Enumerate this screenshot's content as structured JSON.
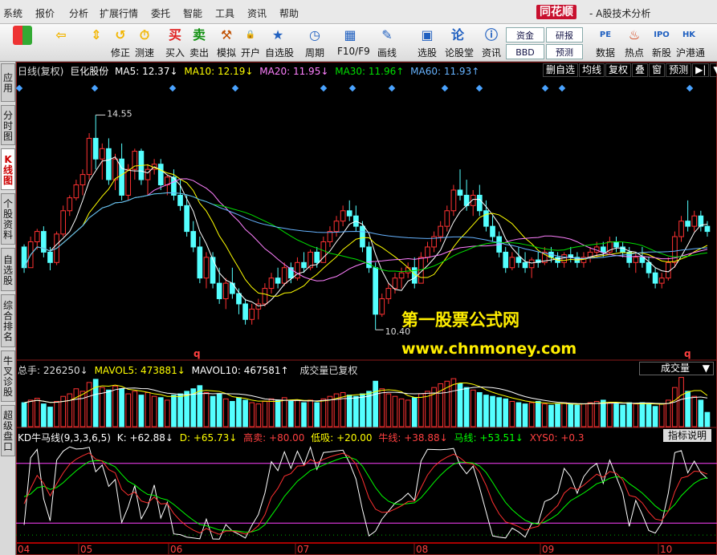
{
  "menu": [
    "系统",
    "报价",
    "分析",
    "扩展行情",
    "委托",
    "智能",
    "工具",
    "资讯",
    "帮助"
  ],
  "brand": {
    "logo": "同花顺",
    "title": "- A股技术分析"
  },
  "toolbar": {
    "items": [
      {
        "name": "home",
        "label": ""
      },
      {
        "name": "back",
        "label": ""
      },
      {
        "name": "updown",
        "label": ""
      },
      {
        "name": "correct",
        "label": "修正"
      },
      {
        "name": "speed",
        "label": "测速"
      },
      {
        "name": "buy",
        "label": "买入"
      },
      {
        "name": "sell",
        "label": "卖出"
      },
      {
        "name": "simulate",
        "label": "模拟"
      },
      {
        "name": "open-account",
        "label": "开户"
      },
      {
        "name": "watchlist",
        "label": "自选股"
      },
      {
        "name": "period",
        "label": "周期"
      },
      {
        "name": "f10",
        "label": "F10/F9"
      },
      {
        "name": "draw",
        "label": "画线"
      },
      {
        "name": "select-stock",
        "label": "选股"
      },
      {
        "name": "forum",
        "label": "论股堂"
      },
      {
        "name": "news",
        "label": "资讯"
      },
      {
        "name": "data",
        "label": "数据"
      },
      {
        "name": "hot",
        "label": "热点"
      },
      {
        "name": "new-stock",
        "label": "新股"
      },
      {
        "name": "hk-connect",
        "label": "沪港通"
      }
    ],
    "small_buttons": [
      "资金",
      "研报",
      "BBD",
      "预测"
    ]
  },
  "sidebar": [
    "应用",
    "分时图",
    "K线图",
    "个股资料",
    "自选股",
    "综合排名",
    "牛叉诊股",
    "超级盘口"
  ],
  "price_panel": {
    "legend": {
      "label": "日线(复权)",
      "stock": "巨化股份",
      "ma5": "MA5: 12.37↓",
      "ma10": "MA10: 12.19↓",
      "ma20": "MA20: 11.95↓",
      "ma30": "MA30: 11.96↑",
      "ma60": "MA60: 11.93↑"
    },
    "buttons": [
      "删自选",
      "均线",
      "复权",
      "叠",
      "窗",
      "预测"
    ],
    "max_label": "14.55",
    "min_label": "10.40",
    "marker": "q"
  },
  "volume_panel": {
    "legend": {
      "total": "总手: 226250↓",
      "mavol5": "MAVOL5: 473881↓",
      "mavol10": "MAVOL10: 467581↑",
      "note": "成交量已复权"
    },
    "selector": "成交量"
  },
  "kd_panel": {
    "legend": {
      "name": "KD牛马线(9,3,3,6,5)",
      "k": "K: +62.88↓",
      "d": "D: +65.73↓",
      "high": "高卖: +80.00",
      "low": "低吸: +20.00",
      "bull": "牛线: +38.88↓",
      "horse": "马线: +53.51↓",
      "xys": "XYS0: +0.3"
    },
    "button": "指标说明"
  },
  "x_axis": [
    "04",
    "05",
    "06",
    "07",
    "08",
    "09",
    "10"
  ],
  "watermark": [
    "第一股票公式网",
    "www.chnmoney.com"
  ],
  "colors": {
    "up": "#ff3232",
    "down": "#54ffff",
    "ma5": "#ffffff",
    "ma10": "#ffff00",
    "ma20": "#ff80ff",
    "ma30": "#00e000",
    "ma60": "#66b3ff",
    "kline": "#ff3030",
    "dline": "#00ff00",
    "jline": "#ffffff"
  },
  "chart_data": {
    "type": "candlestick",
    "price_range": [
      10.0,
      15.3
    ],
    "ohlc": [
      [
        12.0,
        12.05,
        11.5,
        11.6
      ],
      [
        11.6,
        12.2,
        11.6,
        12.1
      ],
      [
        12.1,
        12.35,
        11.95,
        12.3
      ],
      [
        12.3,
        12.4,
        11.8,
        11.9
      ],
      [
        11.9,
        12.0,
        11.55,
        11.7
      ],
      [
        11.7,
        12.3,
        11.65,
        12.25
      ],
      [
        12.25,
        12.8,
        12.2,
        12.7
      ],
      [
        12.7,
        13.0,
        12.6,
        12.95
      ],
      [
        12.95,
        13.3,
        12.9,
        13.2
      ],
      [
        13.2,
        13.5,
        13.0,
        13.4
      ],
      [
        13.4,
        14.2,
        13.3,
        14.1
      ],
      [
        14.1,
        14.55,
        13.5,
        13.7
      ],
      [
        13.7,
        14.0,
        13.3,
        13.9
      ],
      [
        13.9,
        14.1,
        13.2,
        13.3
      ],
      [
        13.3,
        13.8,
        13.1,
        13.7
      ],
      [
        13.7,
        14.0,
        12.9,
        13.0
      ],
      [
        13.0,
        13.6,
        12.9,
        13.5
      ],
      [
        13.5,
        13.9,
        13.3,
        13.85
      ],
      [
        13.85,
        13.9,
        13.2,
        13.3
      ],
      [
        13.3,
        13.6,
        13.0,
        13.5
      ],
      [
        13.5,
        13.7,
        13.4,
        13.6
      ],
      [
        13.6,
        13.7,
        13.1,
        13.2
      ],
      [
        13.2,
        13.4,
        13.0,
        13.35
      ],
      [
        13.35,
        13.5,
        12.9,
        13.0
      ],
      [
        13.0,
        13.3,
        12.7,
        12.8
      ],
      [
        12.8,
        13.0,
        12.2,
        12.3
      ],
      [
        12.3,
        12.5,
        11.9,
        12.0
      ],
      [
        12.0,
        12.2,
        11.3,
        11.4
      ],
      [
        11.4,
        11.9,
        11.2,
        11.8
      ],
      [
        11.8,
        11.9,
        11.2,
        11.3
      ],
      [
        11.3,
        11.6,
        10.9,
        11.0
      ],
      [
        11.0,
        11.4,
        10.8,
        11.3
      ],
      [
        11.3,
        11.6,
        11.0,
        11.1
      ],
      [
        11.1,
        11.2,
        10.7,
        10.9
      ],
      [
        10.9,
        11.0,
        10.5,
        10.6
      ],
      [
        10.6,
        10.9,
        10.5,
        10.8
      ],
      [
        10.8,
        11.0,
        10.6,
        10.9
      ],
      [
        10.9,
        11.3,
        10.85,
        11.2
      ],
      [
        11.2,
        11.5,
        11.1,
        11.4
      ],
      [
        11.4,
        11.6,
        11.2,
        11.3
      ],
      [
        11.3,
        11.7,
        11.25,
        11.6
      ],
      [
        11.6,
        11.7,
        11.3,
        11.4
      ],
      [
        11.4,
        11.8,
        11.35,
        11.7
      ],
      [
        11.7,
        11.9,
        11.5,
        11.6
      ],
      [
        11.6,
        11.95,
        11.55,
        11.9
      ],
      [
        11.9,
        12.0,
        11.6,
        11.7
      ],
      [
        11.7,
        12.2,
        11.7,
        12.1
      ],
      [
        12.1,
        12.4,
        12.0,
        12.3
      ],
      [
        12.3,
        12.6,
        12.2,
        12.5
      ],
      [
        12.5,
        12.8,
        12.4,
        12.7
      ],
      [
        12.7,
        12.9,
        12.5,
        12.6
      ],
      [
        12.6,
        12.8,
        12.3,
        12.4
      ],
      [
        12.4,
        12.5,
        11.9,
        12.0
      ],
      [
        12.0,
        12.1,
        11.5,
        11.6
      ],
      [
        11.6,
        11.7,
        10.4,
        10.7
      ],
      [
        10.7,
        11.1,
        10.65,
        11.0
      ],
      [
        11.0,
        11.3,
        10.9,
        11.2
      ],
      [
        11.2,
        11.5,
        11.1,
        11.4
      ],
      [
        11.4,
        11.6,
        11.2,
        11.5
      ],
      [
        11.5,
        11.7,
        11.4,
        11.6
      ],
      [
        11.6,
        11.8,
        11.2,
        11.3
      ],
      [
        11.3,
        11.9,
        11.3,
        11.8
      ],
      [
        11.8,
        12.1,
        11.7,
        12.0
      ],
      [
        12.0,
        12.3,
        11.9,
        12.2
      ],
      [
        12.2,
        12.5,
        12.1,
        12.4
      ],
      [
        12.4,
        12.8,
        12.3,
        12.7
      ],
      [
        12.7,
        13.2,
        12.6,
        13.1
      ],
      [
        13.1,
        13.5,
        12.9,
        13.0
      ],
      [
        13.0,
        13.3,
        12.7,
        12.8
      ],
      [
        12.8,
        13.1,
        12.6,
        13.0
      ],
      [
        13.0,
        13.2,
        12.6,
        12.7
      ],
      [
        12.7,
        12.9,
        12.3,
        12.4
      ],
      [
        12.4,
        12.6,
        12.1,
        12.2
      ],
      [
        12.2,
        12.3,
        11.8,
        11.9
      ],
      [
        11.9,
        12.0,
        11.5,
        11.6
      ],
      [
        11.6,
        11.9,
        11.55,
        11.8
      ],
      [
        11.8,
        12.0,
        11.6,
        11.7
      ],
      [
        11.7,
        11.9,
        11.5,
        11.6
      ],
      [
        11.6,
        11.8,
        11.4,
        11.75
      ],
      [
        11.75,
        11.9,
        11.6,
        11.7
      ],
      [
        11.7,
        12.0,
        11.65,
        11.9
      ],
      [
        11.9,
        12.0,
        11.7,
        11.8
      ],
      [
        11.8,
        11.9,
        11.6,
        11.7
      ],
      [
        11.7,
        11.9,
        11.6,
        11.85
      ],
      [
        11.85,
        12.0,
        11.7,
        11.8
      ],
      [
        11.8,
        11.9,
        11.6,
        11.7
      ],
      [
        11.7,
        11.9,
        11.6,
        11.8
      ],
      [
        11.8,
        12.0,
        11.7,
        11.9
      ],
      [
        11.9,
        12.1,
        11.8,
        12.0
      ],
      [
        12.0,
        12.1,
        11.8,
        11.9
      ],
      [
        11.9,
        12.2,
        11.85,
        12.1
      ],
      [
        12.1,
        12.2,
        11.9,
        12.0
      ],
      [
        12.0,
        12.1,
        11.8,
        11.9
      ],
      [
        11.9,
        12.0,
        11.6,
        11.7
      ],
      [
        11.7,
        11.9,
        11.5,
        11.8
      ],
      [
        11.8,
        12.0,
        11.6,
        11.7
      ],
      [
        11.7,
        11.8,
        11.4,
        11.5
      ],
      [
        11.5,
        11.6,
        11.2,
        11.3
      ],
      [
        11.3,
        11.5,
        11.2,
        11.4
      ],
      [
        11.4,
        11.8,
        11.35,
        11.7
      ],
      [
        11.7,
        12.3,
        11.6,
        12.2
      ],
      [
        12.2,
        12.6,
        12.1,
        12.5
      ],
      [
        12.5,
        12.9,
        12.3,
        12.4
      ],
      [
        12.4,
        12.7,
        12.3,
        12.6
      ],
      [
        12.6,
        12.7,
        12.3,
        12.4
      ],
      [
        12.4,
        12.5,
        12.2,
        12.3
      ]
    ],
    "volume_range": [
      0,
      800000
    ],
    "volume": [
      380000,
      420000,
      450000,
      360000,
      310000,
      400000,
      480000,
      520000,
      600000,
      560000,
      700000,
      750000,
      620000,
      580000,
      640000,
      600000,
      520000,
      560000,
      500000,
      540000,
      480000,
      460000,
      420000,
      500000,
      520000,
      560000,
      600000,
      650000,
      540000,
      480000,
      520000,
      440000,
      400000,
      460000,
      420000,
      380000,
      360000,
      400000,
      440000,
      420000,
      460000,
      400000,
      420000,
      380000,
      420000,
      380000,
      440000,
      480000,
      520000,
      540000,
      500000,
      480000,
      520000,
      560000,
      720000,
      600000,
      520000,
      480000,
      440000,
      420000,
      460000,
      520000,
      560000,
      620000,
      680000,
      720000,
      760000,
      680000,
      620000,
      580000,
      540000,
      500000,
      480000,
      460000,
      440000,
      400000,
      380000,
      360000,
      380000,
      400000,
      360000,
      340000,
      360000,
      380000,
      360000,
      340000,
      360000,
      380000,
      400000,
      420000,
      380000,
      360000,
      340000,
      380000,
      360000,
      380000,
      360000,
      320000,
      360000,
      420000,
      620000,
      780000,
      560000,
      480000,
      420000,
      226250
    ],
    "kd_range": [
      0,
      100
    ],
    "kd_levels": {
      "high": 80,
      "low": 20
    }
  }
}
